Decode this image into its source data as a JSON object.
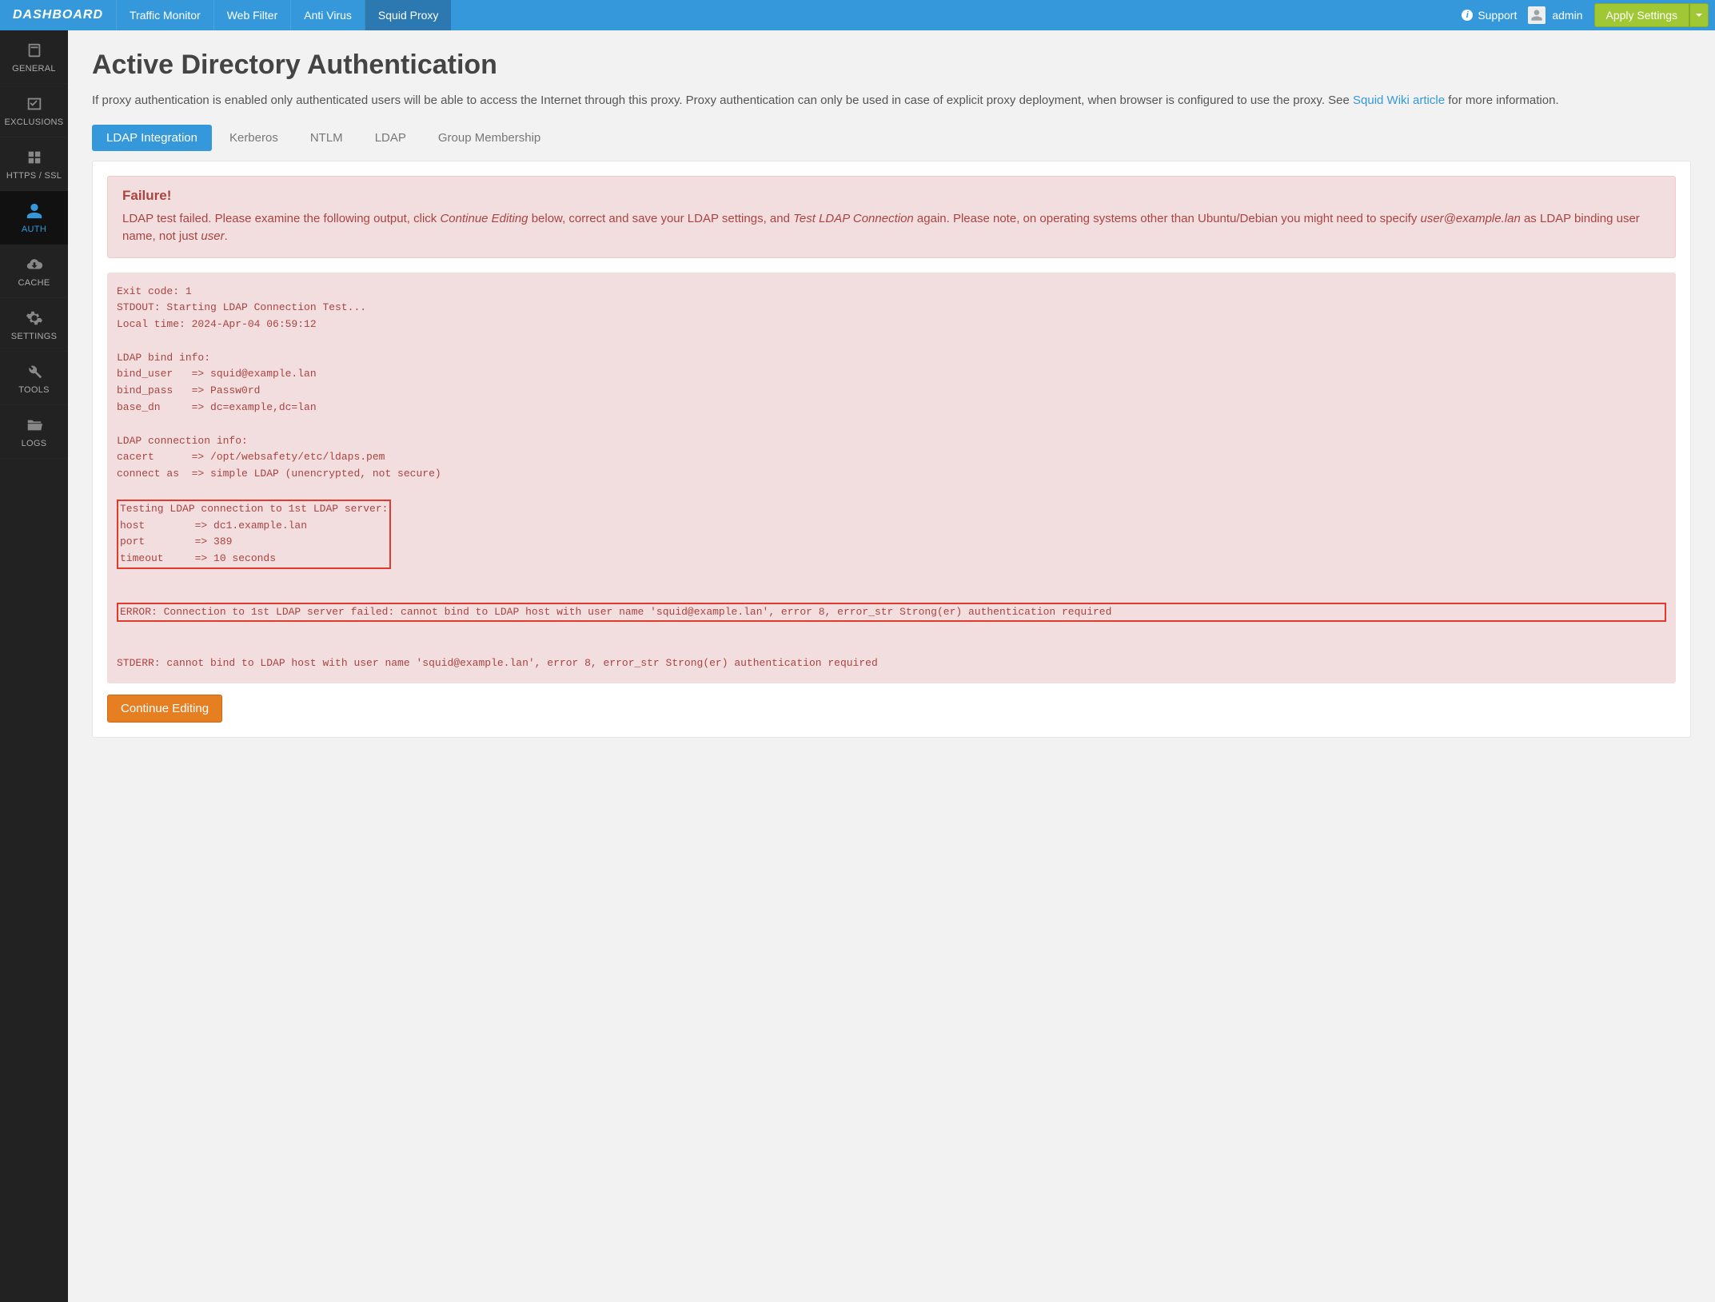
{
  "brand": "DASHBOARD",
  "topnav": [
    {
      "label": "Traffic Monitor",
      "active": false
    },
    {
      "label": "Web Filter",
      "active": false
    },
    {
      "label": "Anti Virus",
      "active": false
    },
    {
      "label": "Squid Proxy",
      "active": true
    }
  ],
  "support_label": "Support",
  "user_name": "admin",
  "apply_label": "Apply Settings",
  "sidebar": [
    {
      "label": "GENERAL",
      "icon": "book-icon",
      "active": false
    },
    {
      "label": "EXCLUSIONS",
      "icon": "check-icon",
      "active": false
    },
    {
      "label": "HTTPS / SSL",
      "icon": "grid-icon",
      "active": false
    },
    {
      "label": "AUTH",
      "icon": "user-icon",
      "active": true
    },
    {
      "label": "CACHE",
      "icon": "cloud-icon",
      "active": false
    },
    {
      "label": "SETTINGS",
      "icon": "gear-icon",
      "active": false
    },
    {
      "label": "TOOLS",
      "icon": "wrench-icon",
      "active": false
    },
    {
      "label": "LOGS",
      "icon": "folder-icon",
      "active": false
    }
  ],
  "page": {
    "title": "Active Directory Authentication",
    "desc_pre": "If proxy authentication is enabled only authenticated users will be able to access the Internet through this proxy. Proxy authentication can only be used in case of explicit proxy deployment, when browser is configured to use the proxy. See ",
    "desc_link": "Squid Wiki article",
    "desc_post": " for more information."
  },
  "tabs": [
    {
      "label": "LDAP Integration",
      "active": true
    },
    {
      "label": "Kerberos",
      "active": false
    },
    {
      "label": "NTLM",
      "active": false
    },
    {
      "label": "LDAP",
      "active": false
    },
    {
      "label": "Group Membership",
      "active": false
    }
  ],
  "failure": {
    "heading": "Failure!",
    "text_pre": "LDAP test failed. Please examine the following output, click ",
    "text_em1": "Continue Editing",
    "text_mid1": " below, correct and save your LDAP settings, and ",
    "text_em2": "Test LDAP Connection",
    "text_mid2": " again. Please note, on operating systems other than Ubuntu/Debian you might need to specify ",
    "text_em3": "user@example.lan",
    "text_mid3": " as LDAP binding user name, not just ",
    "text_em4": "user",
    "text_end": "."
  },
  "output": {
    "block1": "Exit code: 1\nSTDOUT: Starting LDAP Connection Test...\nLocal time: 2024-Apr-04 06:59:12\n\nLDAP bind info:\nbind_user   => squid@example.lan\nbind_pass   => Passw0rd\nbase_dn     => dc=example,dc=lan\n\nLDAP connection info:\ncacert      => /opt/websafety/etc/ldaps.pem\nconnect as  => simple LDAP (unencrypted, not secure)\n",
    "highlight1": "Testing LDAP connection to 1st LDAP server:\nhost        => dc1.example.lan\nport        => 389\ntimeout     => 10 seconds",
    "gap1": "\n",
    "highlight2": "ERROR: Connection to 1st LDAP server failed: cannot bind to LDAP host with user name 'squid@example.lan', error 8, error_str Strong(er) authentication required",
    "block3": "\nSTDERR: cannot bind to LDAP host with user name 'squid@example.lan', error 8, error_str Strong(er) authentication required\n"
  },
  "continue_label": "Continue Editing"
}
